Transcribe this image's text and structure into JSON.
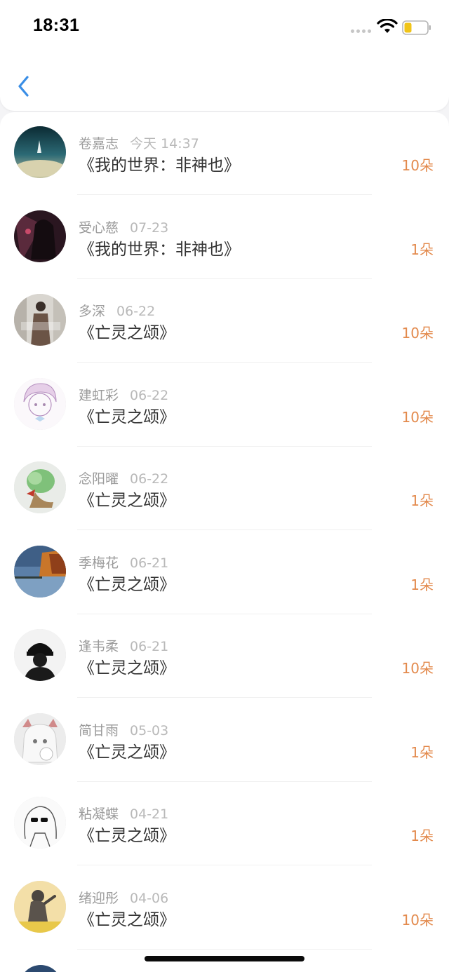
{
  "status_bar": {
    "time": "18:31"
  },
  "records": [
    {
      "name": "卷嘉志",
      "date": "今天 14:37",
      "title": "《我的世界：非神也》",
      "count": "10朵",
      "avatar": "ocean-scene-avatar"
    },
    {
      "name": "受心慈",
      "date": "07-23",
      "title": "《我的世界：非神也》",
      "count": "1朵",
      "avatar": "dark-anime-avatar"
    },
    {
      "name": "多深",
      "date": "06-22",
      "title": "《亡灵之颂》",
      "count": "10朵",
      "avatar": "street-photo-avatar"
    },
    {
      "name": "建虹彩",
      "date": "06-22",
      "title": "《亡灵之颂》",
      "count": "10朵",
      "avatar": "sketch-girl-avatar"
    },
    {
      "name": "念阳曜",
      "date": "06-22",
      "title": "《亡灵之颂》",
      "count": "1朵",
      "avatar": "cabbage-avatar"
    },
    {
      "name": "季梅花",
      "date": "06-21",
      "title": "《亡灵之颂》",
      "count": "1朵",
      "avatar": "autumn-lake-avatar"
    },
    {
      "name": "逢韦柔",
      "date": "06-21",
      "title": "《亡灵之颂》",
      "count": "10朵",
      "avatar": "black-cap-avatar"
    },
    {
      "name": "简甘雨",
      "date": "05-03",
      "title": "《亡灵之颂》",
      "count": "1朵",
      "avatar": "white-hair-anime-avatar"
    },
    {
      "name": "粘凝蝶",
      "date": "04-21",
      "title": "《亡灵之颂》",
      "count": "1朵",
      "avatar": "lineart-sunglasses-avatar"
    },
    {
      "name": "绪迎彤",
      "date": "04-06",
      "title": "《亡灵之颂》",
      "count": "10朵",
      "avatar": "cat-doll-avatar"
    }
  ],
  "colors": {
    "count": "#e38a4d",
    "back": "#3a8ee6"
  }
}
